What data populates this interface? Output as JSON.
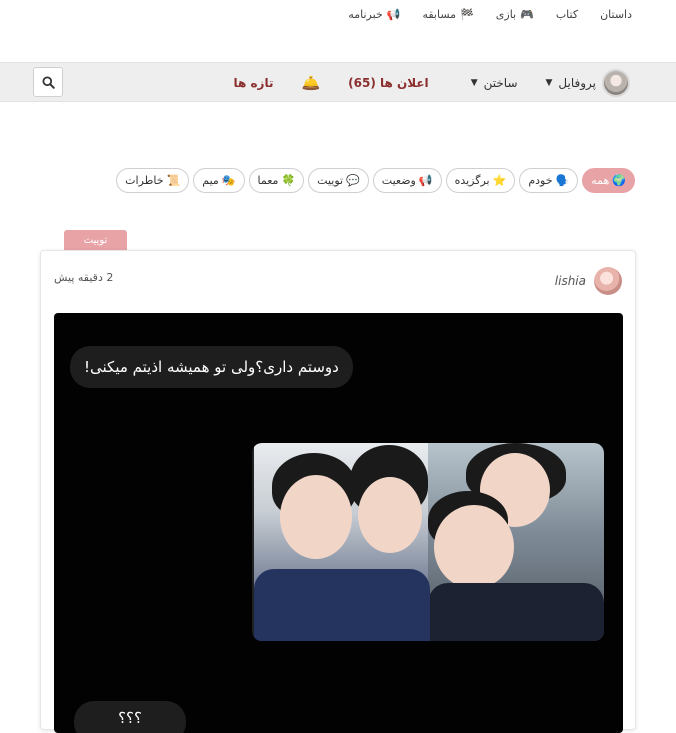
{
  "topnav": {
    "items": [
      {
        "label": "داستان",
        "icon": ""
      },
      {
        "label": "کتاب",
        "icon": ""
      },
      {
        "label": "بازی",
        "icon": "🎮"
      },
      {
        "label": "مسابقه",
        "icon": "🏁"
      },
      {
        "label": "خبرنامه",
        "icon": "📢"
      }
    ]
  },
  "header": {
    "profile_label": "پروفایل",
    "build_label": "ساختن",
    "notifications_label": "اعلان ها (65)",
    "bell_icon": "🛎️",
    "news_label": "تازه ها",
    "search_icon": "search-icon"
  },
  "chips": [
    {
      "label": "همه",
      "emoji": "🌍",
      "active": true
    },
    {
      "label": "خودم",
      "emoji": "🗣️",
      "active": false
    },
    {
      "label": "برگزیده",
      "emoji": "⭐",
      "active": false
    },
    {
      "label": "وضعیت",
      "emoji": "📢",
      "active": false
    },
    {
      "label": "توییت",
      "emoji": "💬",
      "active": false
    },
    {
      "label": "معما",
      "emoji": "🍀",
      "active": false
    },
    {
      "label": "میم",
      "emoji": "🎭",
      "active": false
    },
    {
      "label": "خاطرات",
      "emoji": "📜",
      "active": false
    }
  ],
  "post": {
    "type_tab": "توییت",
    "author": "lishia",
    "time": "2 دقیقه پیش",
    "bubble_text": "دوستم داری؟ولی تو همیشه اذیتم میکنی!",
    "bubble2_text": "؟؟؟"
  },
  "colors": {
    "accent": "#e8a3a6",
    "header_bg": "#eeeeee",
    "notif_text": "#8b2e2e"
  }
}
